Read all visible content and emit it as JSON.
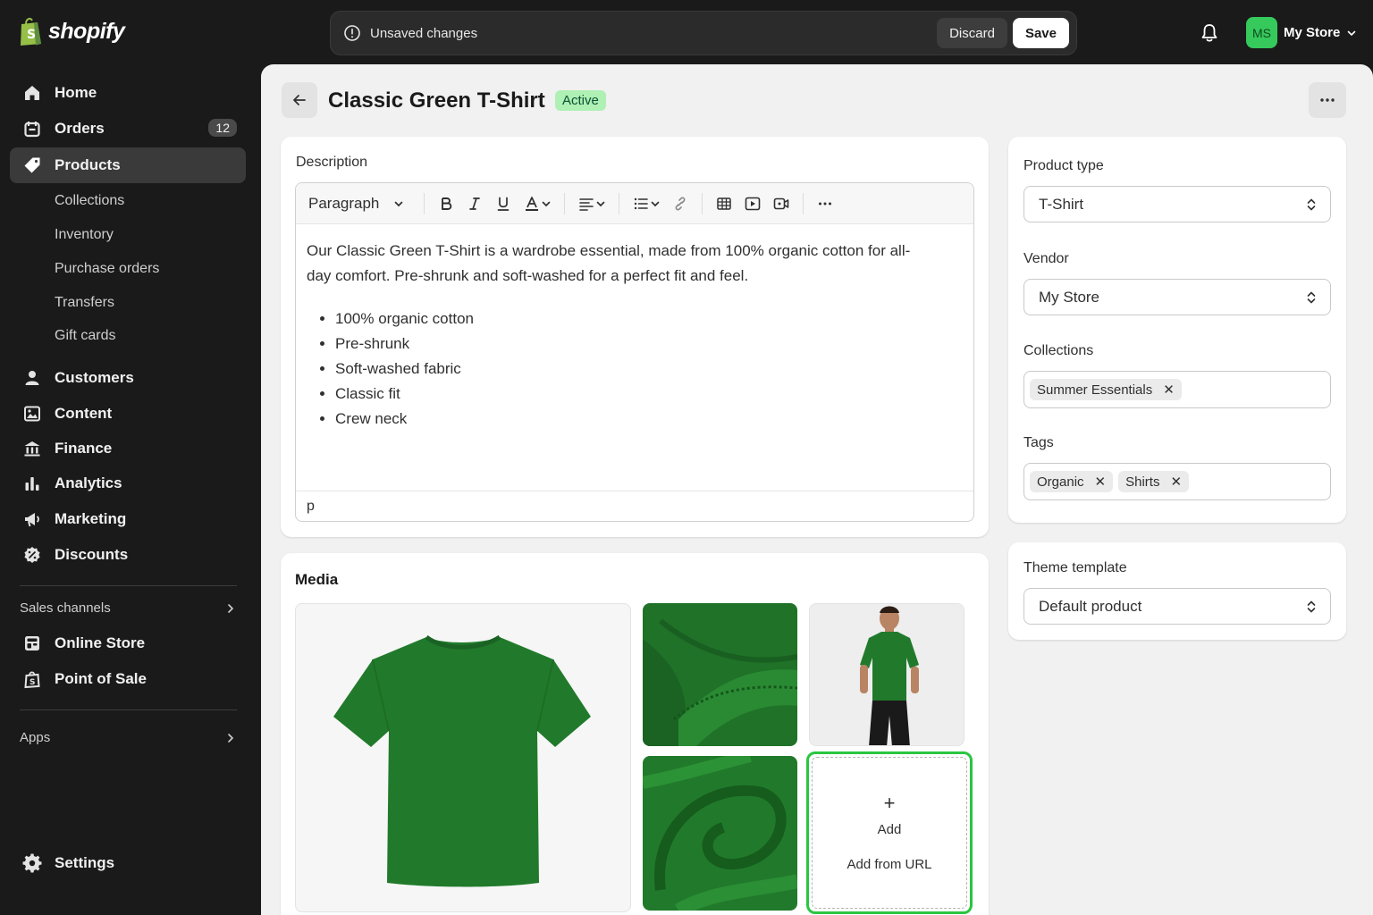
{
  "brand": {
    "logo_text": "shopify"
  },
  "topbar": {
    "unsaved_text": "Unsaved changes",
    "discard_label": "Discard",
    "save_label": "Save",
    "store_initials": "MS",
    "store_name": "My Store"
  },
  "sidebar": {
    "items": [
      {
        "label": "Home",
        "icon": "home-icon"
      },
      {
        "label": "Orders",
        "icon": "orders-icon",
        "badge": "12"
      },
      {
        "label": "Products",
        "icon": "tag-icon",
        "active": true
      },
      {
        "label": "Customers",
        "icon": "person-icon"
      },
      {
        "label": "Content",
        "icon": "image-icon"
      },
      {
        "label": "Finance",
        "icon": "bank-icon"
      },
      {
        "label": "Analytics",
        "icon": "bar-chart-icon"
      },
      {
        "label": "Marketing",
        "icon": "megaphone-icon"
      },
      {
        "label": "Discounts",
        "icon": "discount-icon"
      }
    ],
    "product_subitems": [
      "Collections",
      "Inventory",
      "Purchase orders",
      "Transfers",
      "Gift cards"
    ],
    "sales_channels_label": "Sales channels",
    "channels": [
      {
        "label": "Online Store",
        "icon": "store-icon"
      },
      {
        "label": "Point of Sale",
        "icon": "pos-icon"
      }
    ],
    "apps_label": "Apps",
    "settings_label": "Settings"
  },
  "page": {
    "title": "Classic Green T-Shirt",
    "status": "Active"
  },
  "description": {
    "label": "Description",
    "format_select": "Paragraph",
    "body_text": "Our Classic Green T-Shirt is a wardrobe essential, made from 100% organic cotton for all-day comfort. Pre-shrunk and soft-washed for a perfect fit and feel.",
    "bullets": [
      "100% organic cotton",
      "Pre-shrunk",
      "Soft-washed fabric",
      "Classic fit",
      "Crew neck"
    ],
    "path_indicator": "p"
  },
  "media": {
    "title": "Media",
    "add_label": "Add",
    "add_url_label": "Add from URL"
  },
  "organization": {
    "product_type_label": "Product type",
    "product_type_value": "T-Shirt",
    "vendor_label": "Vendor",
    "vendor_value": "My Store",
    "collections_label": "Collections",
    "collections": [
      "Summer Essentials"
    ],
    "tags_label": "Tags",
    "tags": [
      "Organic",
      "Shirts"
    ]
  },
  "theme": {
    "label": "Theme template",
    "value": "Default product"
  },
  "colors": {
    "sidebar_bg": "#1a1a1a",
    "main_bg": "#f1f1f1",
    "active_badge": "#aff0b5",
    "brand_green": "#95bf47",
    "shirt_green": "#217a2b",
    "focus_ring": "#29c641"
  }
}
